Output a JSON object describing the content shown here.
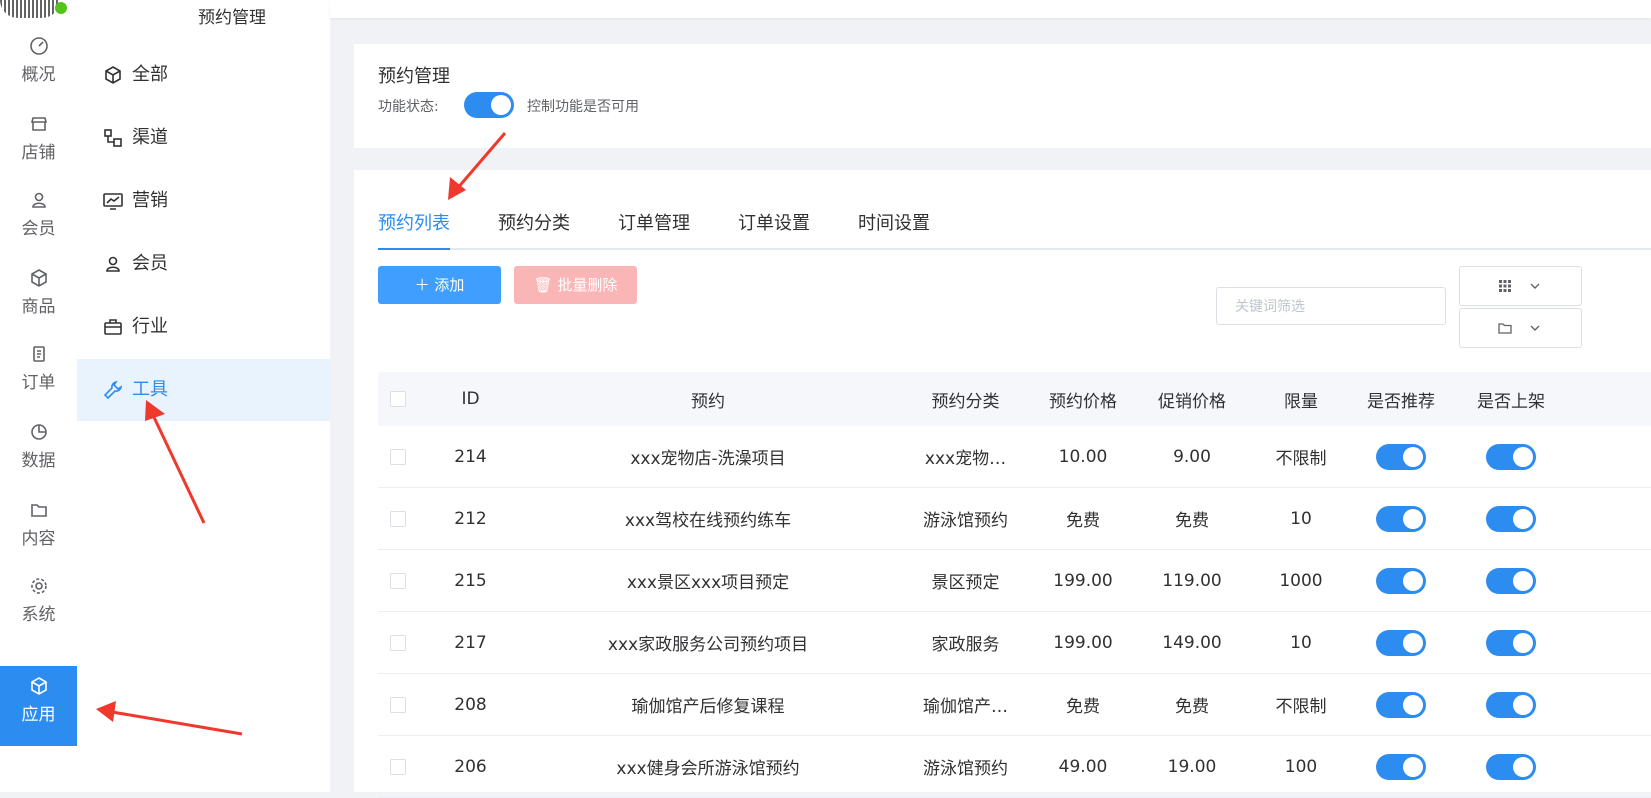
{
  "rail": {
    "items": [
      {
        "label": "概况",
        "icon": "dashboard-icon"
      },
      {
        "label": "店铺",
        "icon": "store-icon"
      },
      {
        "label": "会员",
        "icon": "user-icon"
      },
      {
        "label": "商品",
        "icon": "box-icon"
      },
      {
        "label": "订单",
        "icon": "clipboard-icon"
      },
      {
        "label": "数据",
        "icon": "pie-chart-icon"
      },
      {
        "label": "内容",
        "icon": "folder-icon"
      },
      {
        "label": "系统",
        "icon": "gear-icon"
      },
      {
        "label": "应用",
        "icon": "box-icon"
      }
    ],
    "active": "应用"
  },
  "sub": {
    "title": "预约管理",
    "items": [
      {
        "label": "全部",
        "icon": "box-icon"
      },
      {
        "label": "渠道",
        "icon": "channel-icon"
      },
      {
        "label": "营销",
        "icon": "marketing-icon"
      },
      {
        "label": "会员",
        "icon": "user-icon"
      },
      {
        "label": "行业",
        "icon": "briefcase-icon"
      },
      {
        "label": "工具",
        "icon": "wrench-icon"
      }
    ],
    "active": "工具"
  },
  "header": {
    "title": "预约管理",
    "status_label": "功能状态:",
    "status_on": true,
    "status_hint": "控制功能是否可用"
  },
  "tabs": [
    "预约列表",
    "预约分类",
    "订单管理",
    "订单设置",
    "时间设置"
  ],
  "active_tab": "预约列表",
  "toolbar": {
    "add_label": "添加",
    "batch_delete_label": "批量删除",
    "search_placeholder": "关键词筛选"
  },
  "table": {
    "columns": [
      "ID",
      "预约",
      "预约分类",
      "预约价格",
      "促销价格",
      "限量",
      "是否推荐",
      "是否上架"
    ],
    "rows": [
      {
        "id": "214",
        "name": "xxx宠物店-洗澡项目",
        "category": "xxx宠物…",
        "price": "10.00",
        "promo": "9.00",
        "limit": "不限制",
        "recommend": true,
        "listed": true
      },
      {
        "id": "212",
        "name": "xxx驾校在线预约练车",
        "category": "游泳馆预约",
        "price": "免费",
        "promo": "免费",
        "limit": "10",
        "recommend": true,
        "listed": true
      },
      {
        "id": "215",
        "name": "xxx景区xxx项目预定",
        "category": "景区预定",
        "price": "199.00",
        "promo": "119.00",
        "limit": "1000",
        "recommend": true,
        "listed": true
      },
      {
        "id": "217",
        "name": "xxx家政服务公司预约项目",
        "category": "家政服务",
        "price": "199.00",
        "promo": "149.00",
        "limit": "10",
        "recommend": true,
        "listed": true
      },
      {
        "id": "208",
        "name": "瑜伽馆产后修复课程",
        "category": "瑜伽馆产…",
        "price": "免费",
        "promo": "免费",
        "limit": "不限制",
        "recommend": true,
        "listed": true
      },
      {
        "id": "206",
        "name": "xxx健身会所游泳馆预约",
        "category": "游泳馆预约",
        "price": "49.00",
        "promo": "19.00",
        "limit": "100",
        "recommend": true,
        "listed": true
      }
    ]
  },
  "colors": {
    "accent": "#2d8cf0",
    "danger_light": "#fab6b6",
    "annotation": "#f0382c"
  }
}
